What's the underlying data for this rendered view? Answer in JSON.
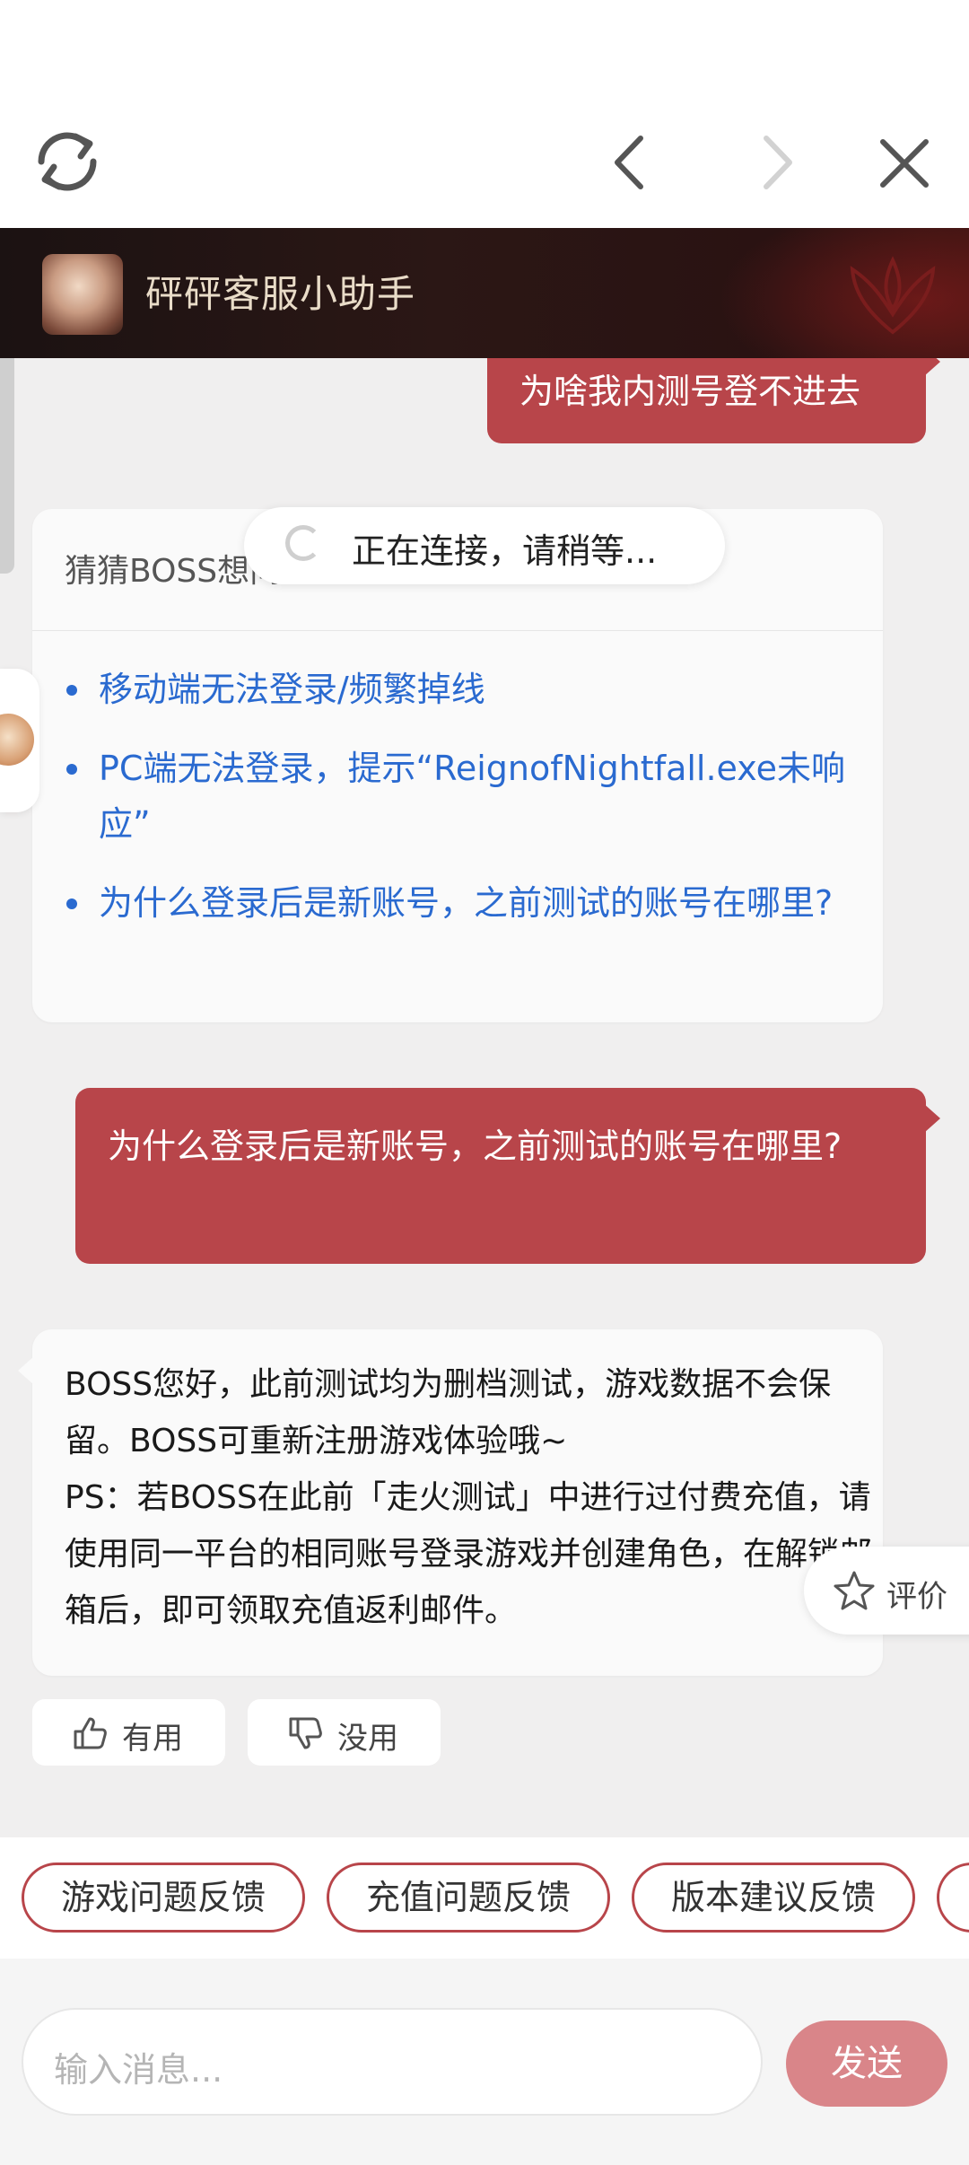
{
  "topbar": {
    "refresh_icon": "refresh-icon",
    "back_icon": "chevron-left-icon",
    "forward_icon": "chevron-right-icon",
    "close_icon": "close-icon"
  },
  "header": {
    "title": "砰砰客服小助手"
  },
  "messages": {
    "user_1": "为啥我内测号登不进去",
    "guess": {
      "title": "猜猜BOSS想问",
      "items": [
        "移动端无法登录/频繁掉线",
        "PC端无法登录，提示“ReignofNightfall.exe未响应”",
        "为什么登录后是新账号，之前测试的账号在哪里?"
      ]
    },
    "user_2": "为什么登录后是新账号，之前测试的账号在哪里?",
    "bot_answer": "BOSS您好，此前测试均为删档测试，游戏数据不会保留。BOSS可重新注册游戏体验哦~\nPS：若BOSS在此前「走火测试」中进行过付费充值，请使用同一平台的相同账号登录游戏并创建角色，在解锁邮箱后，即可领取充值返利邮件。"
  },
  "toast": {
    "text": "正在连接，请稍等..."
  },
  "rate": {
    "label": "评价"
  },
  "feedback": {
    "useful": "有用",
    "useless": "没用"
  },
  "quick_actions": [
    "游戏问题反馈",
    "充值问题反馈",
    "版本建议反馈",
    ""
  ],
  "composer": {
    "placeholder": "输入消息...",
    "send": "发送"
  },
  "colors": {
    "accent": "#b8454a",
    "link": "#2a6ad0",
    "send_button": "#d98589"
  }
}
